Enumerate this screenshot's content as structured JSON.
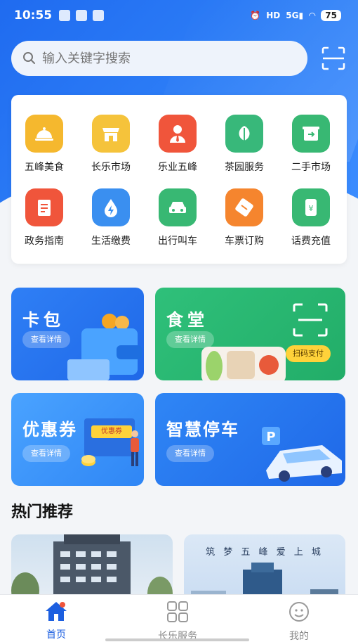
{
  "status": {
    "time": "10:55",
    "battery": "75"
  },
  "search": {
    "placeholder": "输入关键字搜索"
  },
  "grid": [
    {
      "label": "五峰美食",
      "icon": "food-cloche-icon",
      "color": "#f5b82e"
    },
    {
      "label": "长乐市场",
      "icon": "market-stall-icon",
      "color": "#f5c33b"
    },
    {
      "label": "乐业五峰",
      "icon": "person-tie-icon",
      "color": "#f0553b"
    },
    {
      "label": "茶园服务",
      "icon": "tea-leaf-icon",
      "color": "#38b87a"
    },
    {
      "label": "二手市场",
      "icon": "recycle-box-icon",
      "color": "#38b873"
    },
    {
      "label": "政务指南",
      "icon": "document-icon",
      "color": "#f0553b"
    },
    {
      "label": "生活缴费",
      "icon": "water-bolt-icon",
      "color": "#3a8ff0"
    },
    {
      "label": "出行叫车",
      "icon": "car-icon",
      "color": "#38b873"
    },
    {
      "label": "车票订购",
      "icon": "ticket-icon",
      "color": "#f5852e"
    },
    {
      "label": "话费充值",
      "icon": "phone-yen-icon",
      "color": "#38b873"
    }
  ],
  "cards": {
    "kabao": {
      "title": "卡包",
      "pill": "查看详情"
    },
    "shitang": {
      "title": "食堂",
      "pill": "查看详情",
      "pay": "扫码支付"
    },
    "youhuiquan": {
      "title": "优惠券",
      "pill": "查看详情",
      "ticket": "优惠券"
    },
    "parking": {
      "title": "智慧停车",
      "pill": "查看详情"
    }
  },
  "section": {
    "hot_title": "热门推荐"
  },
  "rec": {
    "right_caption": "筑 梦 五 峰 爱 上 城"
  },
  "tabs": [
    {
      "label": "首页",
      "icon": "home-icon"
    },
    {
      "label": "长乐服务",
      "icon": "grid-icon"
    },
    {
      "label": "我的",
      "icon": "chat-face-icon"
    }
  ],
  "colors": {
    "primary": "#1c5fe0",
    "green": "#2fc07a",
    "blue": "#2f7ff5"
  }
}
